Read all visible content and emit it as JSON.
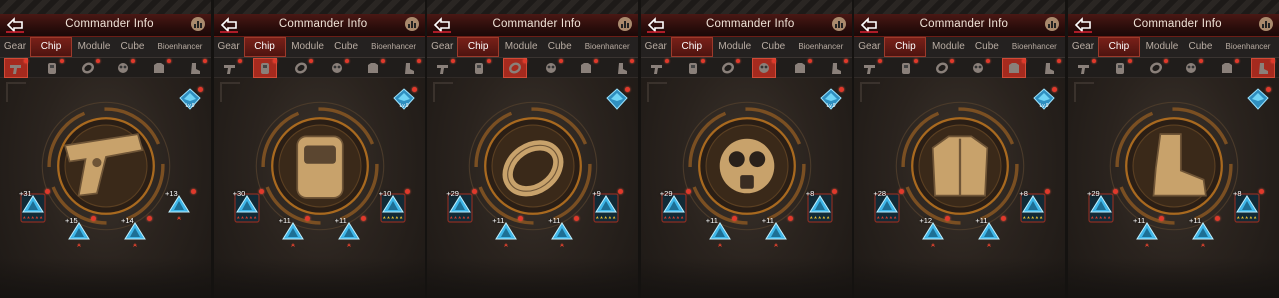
{
  "colors": {
    "accent_red": "#a52a1e",
    "notify_dot": "#e0392b",
    "chip_blue": "#3fb6e8",
    "star_gold": "#f2c230",
    "star_red": "#d8402c",
    "gold_icon": "#c8a26b"
  },
  "panels": [
    {
      "title": "Commander Info",
      "tabs": [
        "Gear",
        "Chip",
        "Module",
        "Cube",
        "Bioenhancer"
      ],
      "active_tab": 1,
      "active_slot": 0,
      "center_icon": "pistol-icon",
      "level_badge": "Lv.9",
      "chips": [
        {
          "plus": "+31",
          "stars": "red5"
        },
        {
          "plus": "+15",
          "stars": "red1"
        },
        {
          "plus": "+14",
          "stars": "red1"
        },
        {
          "plus": "+13",
          "stars": "red1"
        }
      ]
    },
    {
      "title": "Commander Info",
      "tabs": [
        "Gear",
        "Chip",
        "Module",
        "Cube",
        "Bioenhancer"
      ],
      "active_tab": 1,
      "active_slot": 1,
      "center_icon": "helmet-icon",
      "level_badge": "Lv.9",
      "chips": [
        {
          "plus": "+30",
          "stars": "red5"
        },
        {
          "plus": "+11",
          "stars": "red1"
        },
        {
          "plus": "+11",
          "stars": "red1"
        },
        {
          "plus": "+10",
          "stars": "gold5"
        }
      ]
    },
    {
      "title": "Commander Info",
      "tabs": [
        "Gear",
        "Chip",
        "Module",
        "Cube",
        "Bioenhancer"
      ],
      "active_tab": 1,
      "active_slot": 2,
      "center_icon": "ring-icon",
      "level_badge": "",
      "chips": [
        {
          "plus": "+29",
          "stars": "red5"
        },
        {
          "plus": "+11",
          "stars": "red1"
        },
        {
          "plus": "+11",
          "stars": "red1"
        },
        {
          "plus": "+9",
          "stars": "gold5"
        }
      ]
    },
    {
      "title": "Commander Info",
      "tabs": [
        "Gear",
        "Chip",
        "Module",
        "Cube",
        "Bioenhancer"
      ],
      "active_tab": 1,
      "active_slot": 3,
      "center_icon": "gas-mask-icon",
      "level_badge": "Lv.9",
      "chips": [
        {
          "plus": "+29",
          "stars": "red5"
        },
        {
          "plus": "+11",
          "stars": "red1"
        },
        {
          "plus": "+11",
          "stars": "red1"
        },
        {
          "plus": "+8",
          "stars": "gold5"
        }
      ]
    },
    {
      "title": "Commander Info",
      "tabs": [
        "Gear",
        "Chip",
        "Module",
        "Cube",
        "Bioenhancer"
      ],
      "active_tab": 1,
      "active_slot": 4,
      "center_icon": "armor-icon",
      "level_badge": "Lv.9",
      "chips": [
        {
          "plus": "+28",
          "stars": "red5"
        },
        {
          "plus": "+12",
          "stars": "red1"
        },
        {
          "plus": "+11",
          "stars": "red1"
        },
        {
          "plus": "+8",
          "stars": "gold5"
        }
      ]
    },
    {
      "title": "Commander Info",
      "tabs": [
        "Gear",
        "Chip",
        "Module",
        "Cube",
        "Bioenhancer"
      ],
      "active_tab": 1,
      "active_slot": 5,
      "center_icon": "boots-icon",
      "level_badge": "",
      "chips": [
        {
          "plus": "+29",
          "stars": "red5"
        },
        {
          "plus": "+11",
          "stars": "red1"
        },
        {
          "plus": "+11",
          "stars": "red1"
        },
        {
          "plus": "+8",
          "stars": "gold5"
        }
      ]
    }
  ]
}
